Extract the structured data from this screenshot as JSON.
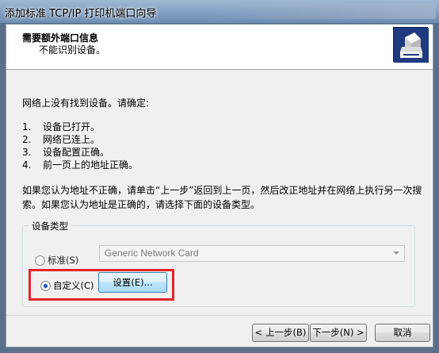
{
  "window": {
    "title": "添加标准 TCP/IP 打印机端口向导"
  },
  "header": {
    "title": "需要额外端口信息",
    "subtitle": "不能识别设备。",
    "logo_icon": "printer-icon"
  },
  "body": {
    "intro": "网络上没有找到设备。请确定:",
    "checklist": [
      {
        "num": "1.",
        "text": "设备已打开。"
      },
      {
        "num": "2.",
        "text": "网络已连上。"
      },
      {
        "num": "3.",
        "text": "设备配置正确。"
      },
      {
        "num": "4.",
        "text": "前一页上的地址正确。"
      }
    ],
    "instruction": "如果您认为地址不正确，请单击“上一步”返回到上一页，然后改正地址并在网络上执行另一次搜索。如果您认为地址是正确的，请选择下面的设备类型。"
  },
  "device_type": {
    "legend": "设备类型",
    "standard_label": "标准(S)",
    "standard_value": "Generic Network Card",
    "custom_label": "自定义(C)",
    "settings_button": "设置(E)...",
    "selected": "custom",
    "highlight_color": "#e0242b"
  },
  "footer": {
    "back_button": "< 上一步(B)",
    "next_button": "下一步(N) >",
    "cancel_button": "取消"
  }
}
